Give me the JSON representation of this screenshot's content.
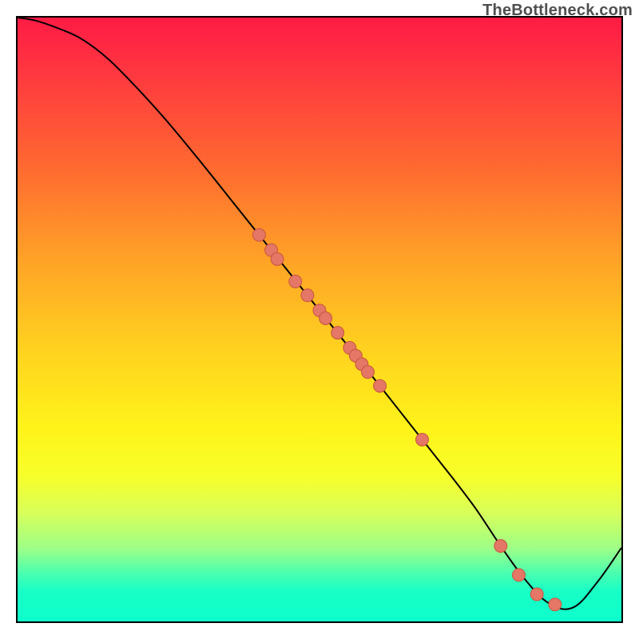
{
  "watermark": "TheBottleneck.com",
  "chart_data": {
    "type": "line",
    "title": "",
    "xlabel": "",
    "ylabel": "",
    "xlim": [
      0,
      100
    ],
    "ylim": [
      0,
      100
    ],
    "grid": false,
    "legend": false,
    "series": [
      {
        "name": "bottleneck-curve",
        "color": "#000000",
        "x": [
          0,
          3,
          6,
          10,
          14,
          18,
          24,
          30,
          36,
          42,
          48,
          54,
          60,
          66,
          72,
          76,
          80,
          84,
          88,
          92,
          96,
          100
        ],
        "y": [
          100,
          99.5,
          98.5,
          96.8,
          94.0,
          90.2,
          83.7,
          76.5,
          69.0,
          61.5,
          54.0,
          46.5,
          39.0,
          31.4,
          23.8,
          18.5,
          12.5,
          7.0,
          3.0,
          2.3,
          6.5,
          12.2
        ]
      }
    ],
    "points": {
      "name": "sample-markers",
      "color": "#e47765",
      "x": [
        40,
        42,
        43,
        46,
        48,
        50,
        51,
        53,
        55,
        56,
        57,
        58,
        60,
        67,
        80,
        83,
        86,
        89
      ],
      "y": [
        64.0,
        61.5,
        60.0,
        56.3,
        54.0,
        51.5,
        50.2,
        47.8,
        45.3,
        44.0,
        42.6,
        41.3,
        39.0,
        30.1,
        12.5,
        7.7,
        4.5,
        2.8
      ]
    }
  }
}
